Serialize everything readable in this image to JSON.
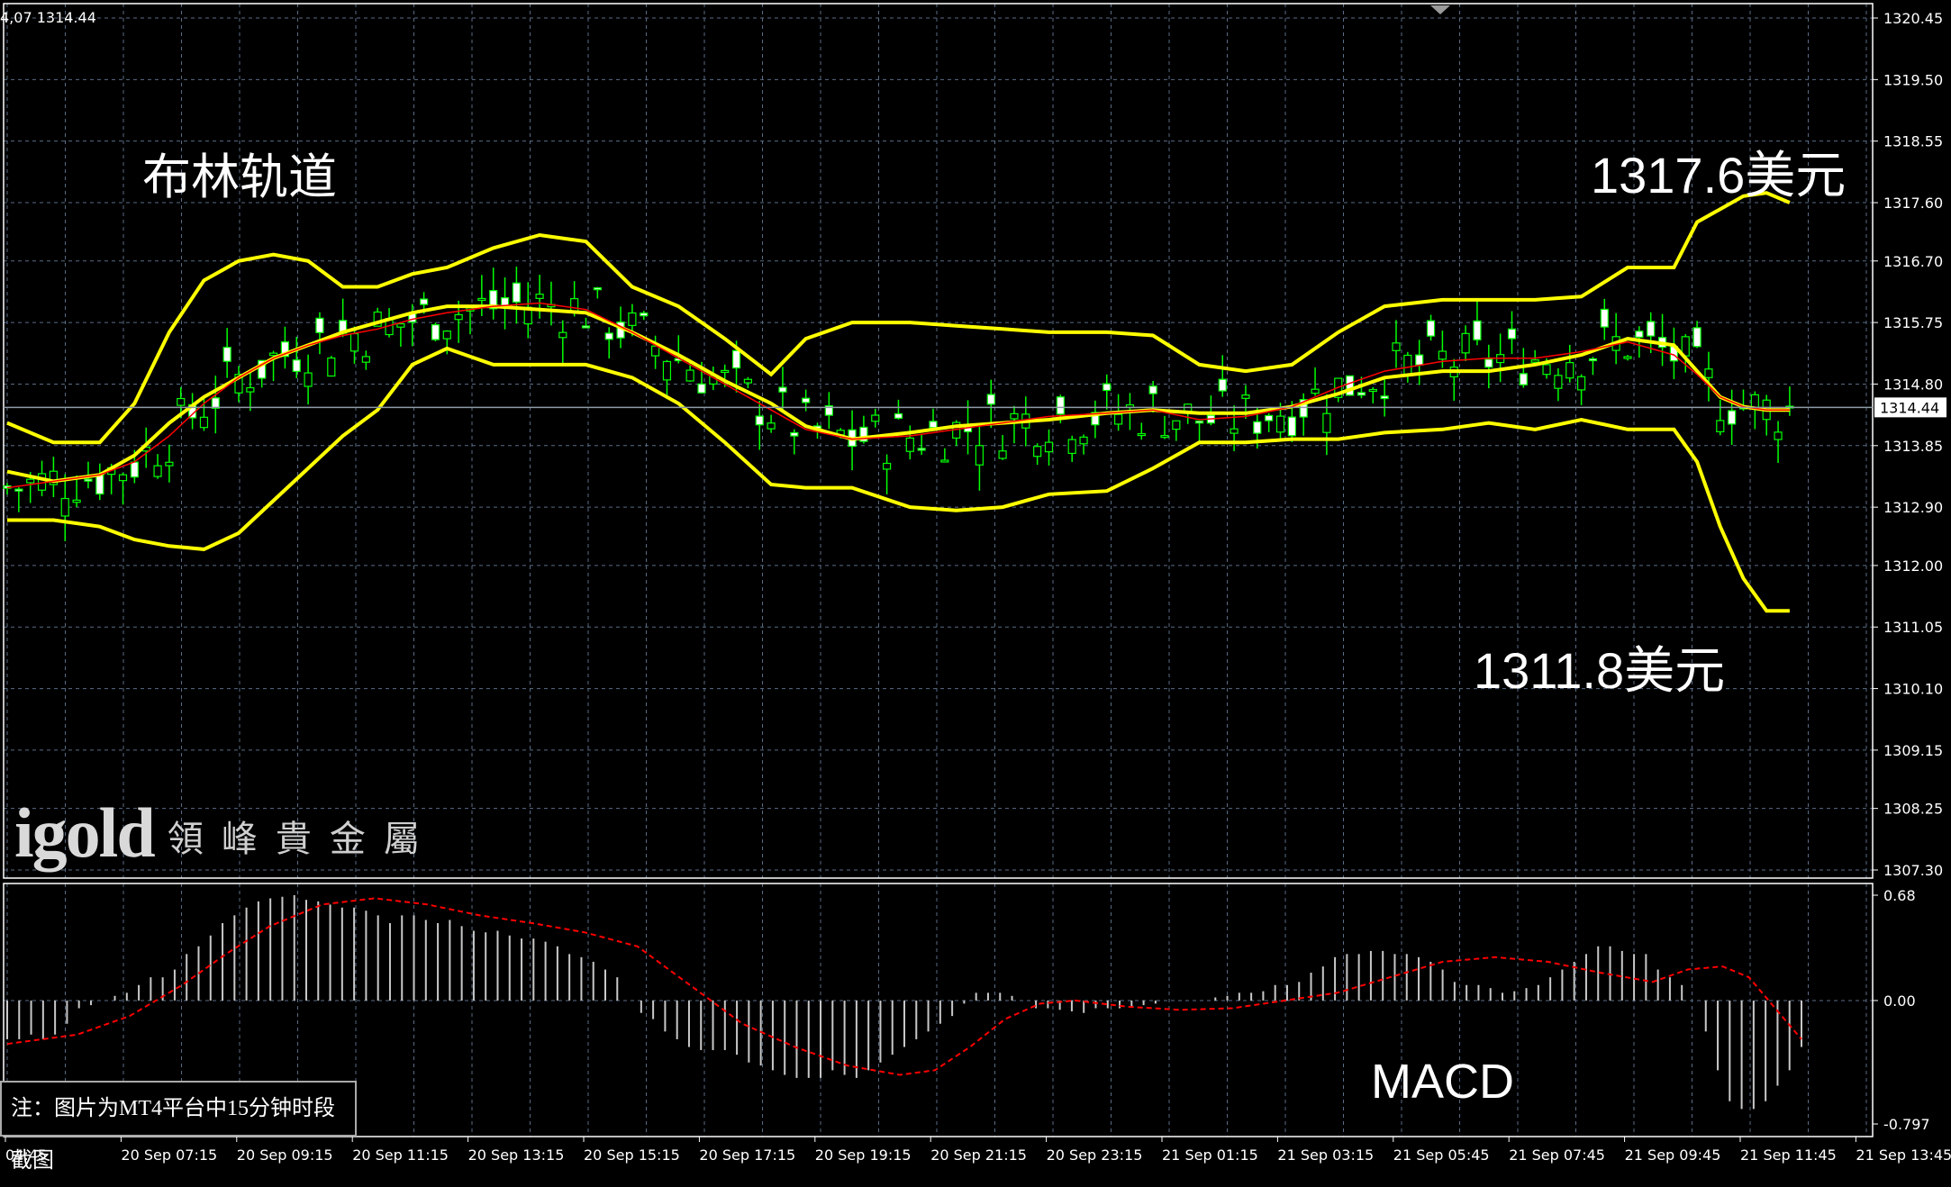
{
  "header": {
    "left_text": "4,07 1314.44"
  },
  "annotations": {
    "title": "布林轨道",
    "high_label": "1317.6美元",
    "low_label": "1311.8美元",
    "macd_label": "MACD",
    "note": "注：图片为MT4平台中15分钟时段截图"
  },
  "logo": {
    "brand": "igold",
    "name": "領峰貴金屬"
  },
  "colors": {
    "background": "#000000",
    "grid": "#5a6c86",
    "frame": "#ffffff",
    "candle": "#00ff00",
    "bollinger": "#ffff00",
    "middle_ma": "#ff0000",
    "macd_hist": "#c8c8c8",
    "macd_signal": "#ff0000",
    "current_price_line": "#8e9aa6"
  },
  "chart_data": [
    {
      "type": "candlestick",
      "panel": "price",
      "title": "",
      "y_axis": {
        "min": 1307.3,
        "max": 1320.45,
        "tick_labels": [
          "1320.45",
          "1319.50",
          "1318.55",
          "1317.60",
          "1316.70",
          "1315.75",
          "1314.80",
          "1313.85",
          "1312.90",
          "1312.00",
          "1311.05",
          "1310.10",
          "1309.15",
          "1308.25",
          "1307.30"
        ]
      },
      "current_price": 1314.44,
      "current_price_label": "1314.44",
      "grid": true,
      "x_axis": {
        "tick_labels": [
          "04:45",
          "20 Sep 07:15",
          "20 Sep 09:15",
          "20 Sep 11:15",
          "20 Sep 13:15",
          "20 Sep 15:15",
          "20 Sep 17:15",
          "20 Sep 19:15",
          "20 Sep 21:15",
          "20 Sep 23:15",
          "21 Sep 01:15",
          "21 Sep 03:15",
          "21 Sep 05:45",
          "21 Sep 07:45",
          "21 Sep 09:45",
          "21 Sep 11:45",
          "21 Sep 13:45"
        ]
      },
      "bollinger": {
        "upper": [
          [
            0,
            1314.2
          ],
          [
            4,
            1313.9
          ],
          [
            8,
            1313.9
          ],
          [
            11,
            1314.5
          ],
          [
            14,
            1315.6
          ],
          [
            17,
            1316.4
          ],
          [
            20,
            1316.7
          ],
          [
            23,
            1316.8
          ],
          [
            26,
            1316.7
          ],
          [
            29,
            1316.3
          ],
          [
            32,
            1316.3
          ],
          [
            35,
            1316.5
          ],
          [
            38,
            1316.6
          ],
          [
            42,
            1316.9
          ],
          [
            46,
            1317.1
          ],
          [
            50,
            1317.0
          ],
          [
            54,
            1316.3
          ],
          [
            58,
            1316.0
          ],
          [
            62,
            1315.5
          ],
          [
            66,
            1314.95
          ],
          [
            69,
            1315.5
          ],
          [
            73,
            1315.75
          ],
          [
            78,
            1315.75
          ],
          [
            82,
            1315.7
          ],
          [
            86,
            1315.65
          ],
          [
            90,
            1315.6
          ],
          [
            95,
            1315.6
          ],
          [
            99,
            1315.55
          ],
          [
            103,
            1315.1
          ],
          [
            107,
            1315.0
          ],
          [
            111,
            1315.1
          ],
          [
            115,
            1315.6
          ],
          [
            119,
            1316.0
          ],
          [
            124,
            1316.1
          ],
          [
            128,
            1316.1
          ],
          [
            132,
            1316.1
          ],
          [
            136,
            1316.15
          ],
          [
            140,
            1316.6
          ],
          [
            144,
            1316.6
          ],
          [
            146,
            1317.3
          ],
          [
            148,
            1317.5
          ],
          [
            150,
            1317.7
          ],
          [
            152,
            1317.75
          ],
          [
            154,
            1317.6
          ]
        ]
      },
      "bollinger_middle_yellow": [
        [
          0,
          1313.45
        ],
        [
          4,
          1313.3
        ],
        [
          8,
          1313.4
        ],
        [
          11,
          1313.7
        ],
        [
          14,
          1314.2
        ],
        [
          17,
          1314.6
        ],
        [
          20,
          1314.9
        ],
        [
          23,
          1315.2
        ],
        [
          26,
          1315.4
        ],
        [
          29,
          1315.6
        ],
        [
          32,
          1315.75
        ],
        [
          35,
          1315.9
        ],
        [
          38,
          1316.0
        ],
        [
          42,
          1316.0
        ],
        [
          46,
          1315.95
        ],
        [
          50,
          1315.9
        ],
        [
          54,
          1315.6
        ],
        [
          58,
          1315.25
        ],
        [
          62,
          1314.85
        ],
        [
          66,
          1314.5
        ],
        [
          69,
          1314.15
        ],
        [
          73,
          1313.95
        ],
        [
          78,
          1314.05
        ],
        [
          82,
          1314.15
        ],
        [
          86,
          1314.2
        ],
        [
          90,
          1314.25
        ],
        [
          95,
          1314.35
        ],
        [
          99,
          1314.4
        ],
        [
          103,
          1314.35
        ],
        [
          107,
          1314.35
        ],
        [
          111,
          1314.45
        ],
        [
          115,
          1314.65
        ],
        [
          119,
          1314.9
        ],
        [
          124,
          1315.0
        ],
        [
          128,
          1315.0
        ],
        [
          132,
          1315.1
        ],
        [
          136,
          1315.25
        ],
        [
          140,
          1315.5
        ],
        [
          144,
          1315.4
        ],
        [
          146,
          1315.0
        ],
        [
          148,
          1314.6
        ],
        [
          150,
          1314.45
        ],
        [
          152,
          1314.4
        ],
        [
          154,
          1314.4
        ]
      ],
      "bollinger_lower": [
        [
          0,
          1312.7
        ],
        [
          4,
          1312.7
        ],
        [
          8,
          1312.6
        ],
        [
          11,
          1312.4
        ],
        [
          14,
          1312.3
        ],
        [
          17,
          1312.25
        ],
        [
          20,
          1312.5
        ],
        [
          23,
          1313.0
        ],
        [
          26,
          1313.5
        ],
        [
          29,
          1314.0
        ],
        [
          32,
          1314.4
        ],
        [
          35,
          1315.1
        ],
        [
          38,
          1315.35
        ],
        [
          42,
          1315.1
        ],
        [
          46,
          1315.1
        ],
        [
          50,
          1315.1
        ],
        [
          54,
          1314.9
        ],
        [
          58,
          1314.5
        ],
        [
          62,
          1313.9
        ],
        [
          66,
          1313.25
        ],
        [
          69,
          1313.2
        ],
        [
          73,
          1313.2
        ],
        [
          78,
          1312.9
        ],
        [
          82,
          1312.85
        ],
        [
          86,
          1312.9
        ],
        [
          90,
          1313.1
        ],
        [
          95,
          1313.15
        ],
        [
          99,
          1313.5
        ],
        [
          103,
          1313.9
        ],
        [
          107,
          1313.9
        ],
        [
          111,
          1313.95
        ],
        [
          115,
          1313.95
        ],
        [
          119,
          1314.05
        ],
        [
          124,
          1314.1
        ],
        [
          128,
          1314.2
        ],
        [
          132,
          1314.1
        ],
        [
          136,
          1314.25
        ],
        [
          140,
          1314.1
        ],
        [
          144,
          1314.1
        ],
        [
          146,
          1313.6
        ],
        [
          148,
          1312.6
        ],
        [
          150,
          1311.8
        ],
        [
          152,
          1311.3
        ],
        [
          154,
          1311.3
        ]
      ],
      "middle_ma_red": [
        [
          0,
          1313.2
        ],
        [
          4,
          1313.3
        ],
        [
          8,
          1313.4
        ],
        [
          11,
          1313.6
        ],
        [
          14,
          1314.0
        ],
        [
          17,
          1314.5
        ],
        [
          20,
          1314.9
        ],
        [
          23,
          1315.2
        ],
        [
          26,
          1315.4
        ],
        [
          29,
          1315.55
        ],
        [
          32,
          1315.65
        ],
        [
          35,
          1315.8
        ],
        [
          38,
          1315.9
        ],
        [
          42,
          1316.0
        ],
        [
          46,
          1316.05
        ],
        [
          50,
          1315.95
        ],
        [
          54,
          1315.6
        ],
        [
          58,
          1315.2
        ],
        [
          62,
          1314.8
        ],
        [
          66,
          1314.4
        ],
        [
          69,
          1314.1
        ],
        [
          73,
          1313.95
        ],
        [
          78,
          1314.0
        ],
        [
          82,
          1314.1
        ],
        [
          86,
          1314.2
        ],
        [
          90,
          1314.3
        ],
        [
          95,
          1314.35
        ],
        [
          99,
          1314.4
        ],
        [
          103,
          1314.25
        ],
        [
          107,
          1314.3
        ],
        [
          111,
          1314.45
        ],
        [
          115,
          1314.75
        ],
        [
          119,
          1315.0
        ],
        [
          124,
          1315.15
        ],
        [
          128,
          1315.2
        ],
        [
          132,
          1315.2
        ],
        [
          136,
          1315.3
        ],
        [
          140,
          1315.45
        ],
        [
          144,
          1315.25
        ],
        [
          146,
          1314.95
        ],
        [
          148,
          1314.6
        ],
        [
          150,
          1314.45
        ],
        [
          152,
          1314.4
        ],
        [
          154,
          1314.4
        ]
      ],
      "annotated_high": 1317.6,
      "annotated_low": 1311.8
    },
    {
      "type": "histogram+line",
      "panel": "MACD",
      "y_axis": {
        "min": -0.797,
        "max": 0.68,
        "tick_labels": [
          "0.68",
          "0.00",
          "-0.797"
        ]
      },
      "histogram": [
        -0.25,
        -0.25,
        -0.22,
        -0.25,
        -0.22,
        -0.15,
        -0.05,
        -0.03,
        0.0,
        0.03,
        0.05,
        0.1,
        0.15,
        0.15,
        0.2,
        0.3,
        0.35,
        0.42,
        0.5,
        0.55,
        0.6,
        0.64,
        0.66,
        0.67,
        0.68,
        0.65,
        0.64,
        0.62,
        0.6,
        0.6,
        0.58,
        0.55,
        0.5,
        0.55,
        0.55,
        0.52,
        0.5,
        0.52,
        0.48,
        0.45,
        0.44,
        0.45,
        0.42,
        0.4,
        0.4,
        0.38,
        0.35,
        0.3,
        0.28,
        0.25,
        0.2,
        0.15,
        0.0,
        -0.08,
        -0.12,
        -0.2,
        -0.25,
        -0.3,
        -0.32,
        -0.32,
        -0.32,
        -0.35,
        -0.4,
        -0.42,
        -0.45,
        -0.48,
        -0.5,
        -0.5,
        -0.5,
        -0.45,
        -0.48,
        -0.5,
        -0.45,
        -0.4,
        -0.35,
        -0.3,
        -0.25,
        -0.2,
        -0.15,
        -0.1,
        -0.02,
        0.05,
        0.05,
        0.05,
        0.03,
        0.0,
        -0.05,
        -0.05,
        -0.06,
        -0.07,
        -0.08,
        -0.05,
        -0.05,
        -0.05,
        -0.04,
        -0.03,
        -0.02,
        0.0,
        0.0,
        0.0,
        0.0,
        0.02,
        0.03,
        0.05,
        0.05,
        0.06,
        0.1,
        0.1,
        0.12,
        0.18,
        0.22,
        0.28,
        0.3,
        0.3,
        0.32,
        0.32,
        0.3,
        0.3,
        0.28,
        0.25,
        0.2,
        0.12,
        0.1,
        0.1,
        0.08,
        0.05,
        0.06,
        0.08,
        0.1,
        0.15,
        0.2,
        0.25,
        0.3,
        0.35,
        0.35,
        0.32,
        0.3,
        0.3,
        0.2,
        0.15,
        0.1,
        0.0,
        -0.2,
        -0.45,
        -0.65,
        -0.7,
        -0.7,
        -0.65,
        -0.55,
        -0.45,
        -0.3
      ],
      "signal": [
        [
          0,
          -0.28
        ],
        [
          8,
          -0.22
        ],
        [
          14,
          -0.1
        ],
        [
          20,
          0.1
        ],
        [
          25,
          0.3
        ],
        [
          30,
          0.48
        ],
        [
          36,
          0.62
        ],
        [
          42,
          0.66
        ],
        [
          48,
          0.62
        ],
        [
          54,
          0.55
        ],
        [
          60,
          0.5
        ],
        [
          66,
          0.44
        ],
        [
          72,
          0.35
        ],
        [
          78,
          0.1
        ],
        [
          84,
          -0.15
        ],
        [
          90,
          -0.3
        ],
        [
          96,
          -0.42
        ],
        [
          102,
          -0.48
        ],
        [
          106,
          -0.45
        ],
        [
          110,
          -0.3
        ],
        [
          114,
          -0.12
        ],
        [
          118,
          -0.02
        ],
        [
          122,
          0.0
        ],
        [
          128,
          -0.04
        ],
        [
          134,
          -0.06
        ],
        [
          140,
          -0.05
        ],
        [
          146,
          0.0
        ],
        [
          152,
          0.05
        ],
        [
          158,
          0.15
        ],
        [
          164,
          0.25
        ],
        [
          170,
          0.28
        ],
        [
          176,
          0.25
        ],
        [
          182,
          0.18
        ],
        [
          188,
          0.12
        ],
        [
          192,
          0.2
        ],
        [
          196,
          0.22
        ],
        [
          199,
          0.15
        ],
        [
          202,
          -0.05
        ],
        [
          205,
          -0.25
        ]
      ]
    }
  ]
}
